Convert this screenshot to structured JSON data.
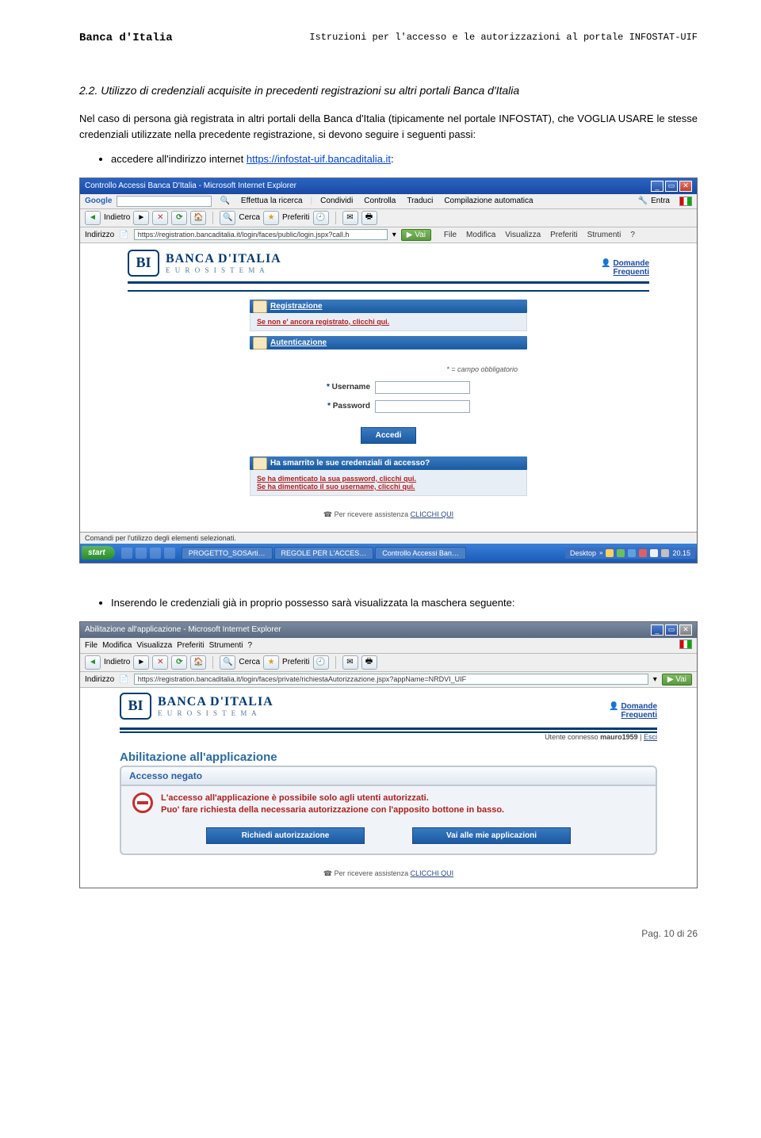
{
  "header": {
    "left": "Banca d'Italia",
    "right": "Istruzioni per l'accesso e le autorizzazioni al portale INFOSTAT-UIF"
  },
  "section": {
    "number": "2.2.",
    "title": "Utilizzo di credenziali acquisite in precedenti registrazioni su altri portali Banca d'Italia"
  },
  "paragraph1": "Nel caso di persona già registrata in altri portali della Banca d'Italia (tipicamente nel portale INFOSTAT), che VOGLIA USARE le stesse credenziali utilizzate nella precedente registrazione, si devono seguire i seguenti passi:",
  "bullet1_lead": "accedere all'indirizzo internet ",
  "bullet1_link": "https://infostat-uif.bancaditalia.it",
  "bullet1_after": ":",
  "bullet2": "Inserendo le credenziali già in proprio possesso sarà visualizzata la maschera seguente:",
  "shot1": {
    "title": "Controllo Accessi Banca D'Italia - Microsoft Internet Explorer",
    "google_items": [
      "Effettua la ricerca",
      "Condividi",
      "Controlla",
      "Traduci",
      "Compilazione automatica"
    ],
    "google_entra": "Entra",
    "nav": {
      "indietro": "Indietro",
      "cerca": "Cerca",
      "preferiti": "Preferiti"
    },
    "addr_label": "Indirizzo",
    "addr_value": "https://registration.bancaditalia.it/login/faces/public/login.jspx?call.h",
    "go": "Vai",
    "menu": [
      "File",
      "Modifica",
      "Visualizza",
      "Preferiti",
      "Strumenti",
      "?"
    ],
    "logo1": "BANCA D'ITALIA",
    "logo2": "E U R O S I S T E M A",
    "faq1": "Domande",
    "faq2": "Frequenti",
    "reg_head": "Registrazione",
    "reg_body": "Se non e' ancora registrato, clicchi qui.",
    "auth_head": "Autenticazione",
    "mandatory": "* = campo obbligatorio",
    "username": "Username",
    "password": "Password",
    "accedi": "Accedi",
    "lost_head": "Ha smarrito le sue credenziali di accesso?",
    "lost1": "Se ha dimenticato la sua password, clicchi qui.",
    "lost2": "Se ha dimenticato il suo username, clicchi qui.",
    "assist_lead": "Per ricevere assistenza ",
    "assist_link": "CLICCHI QUI",
    "status": "Comandi per l'utilizzo degli elementi selezionati.",
    "taskbar": {
      "start": "start",
      "tasks": [
        "PROGETTO_SOSArti…",
        "REGOLE PER L'ACCES…",
        "Controllo Accessi Ban…"
      ],
      "desktop": "Desktop",
      "time": "20.15"
    }
  },
  "shot2": {
    "title": "Abilitazione all'applicazione - Microsoft Internet Explorer",
    "menu": [
      "File",
      "Modifica",
      "Visualizza",
      "Preferiti",
      "Strumenti",
      "?"
    ],
    "nav": {
      "indietro": "Indietro",
      "cerca": "Cerca",
      "preferiti": "Preferiti"
    },
    "addr_label": "Indirizzo",
    "addr_value": "https://registration.bancaditalia.it/login/faces/private/richiestaAutorizzazione.jspx?appName=NRDVI_UIF",
    "go": "Vai",
    "logo1": "BANCA D'ITALIA",
    "logo2": "E U R O S I S T E M A",
    "faq1": "Domande",
    "faq2": "Frequenti",
    "user_label": "Utente connesso ",
    "user_value": "mauro1959",
    "user_sep": " | ",
    "user_exit": "Esci",
    "app_title": "Abilitazione all'applicazione",
    "deny_title": "Accesso negato",
    "deny_line1": "L'accesso all'applicazione è possibile solo agli utenti autorizzati.",
    "deny_line2": "Puo' fare richiesta della necessaria autorizzazione con l'apposito bottone in basso.",
    "btn1": "Richiedi autorizzazione",
    "btn2": "Vai alle mie applicazioni",
    "assist_lead": "Per ricevere assistenza ",
    "assist_link": "CLICCHI QUI"
  },
  "footer": "Pag. 10 di 26"
}
